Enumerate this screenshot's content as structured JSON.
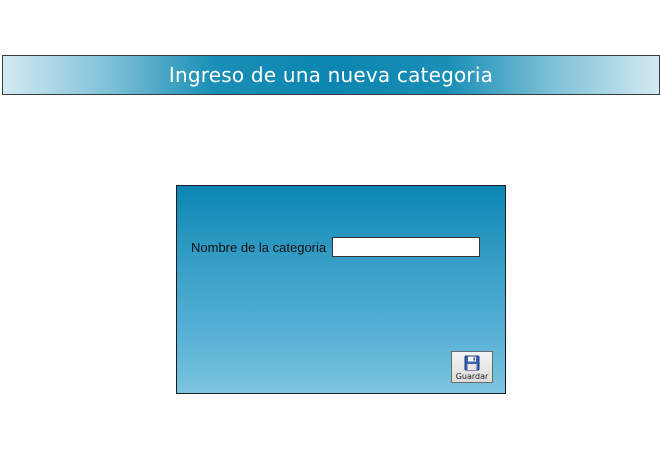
{
  "header": {
    "title": "Ingreso de una nueva categoria"
  },
  "form": {
    "name_label": "Nombre de la categoria",
    "name_value": "",
    "save_label": "Guardar",
    "save_icon": "floppy-disk-icon"
  },
  "colors": {
    "title_bar_center": "#0b85b0",
    "title_bar_edge": "#d4eaf2",
    "panel_top": "#0b86b3",
    "panel_bottom": "#7cc5e0"
  }
}
